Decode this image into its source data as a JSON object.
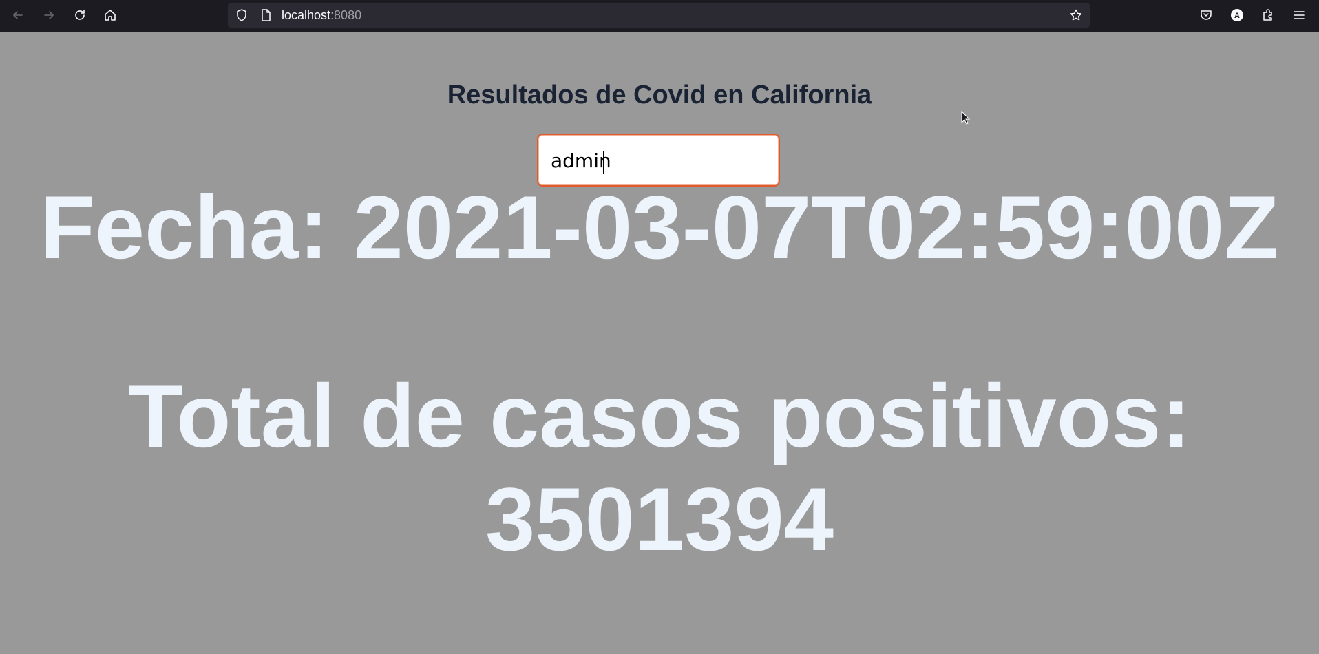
{
  "browser": {
    "url_host": "localhost",
    "url_port": ":8080"
  },
  "page": {
    "title": "Resultados de Covid en California",
    "input_value": "admin",
    "fecha_label": "Fecha: ",
    "fecha_value": "2021-03-07T02:59:00Z",
    "total_label": "Total de casos positivos: ",
    "total_value": "3501394"
  },
  "colors": {
    "background": "#999999",
    "title": "#1a2333",
    "big_text": "#edf4fb",
    "input_border": "#e05a2b"
  },
  "icons": [
    "back-arrow-icon",
    "forward-arrow-icon",
    "reload-icon",
    "home-icon",
    "shield-icon",
    "page-icon",
    "bookmark-star-icon",
    "pocket-icon",
    "account-icon",
    "extensions-icon",
    "menu-icon"
  ]
}
